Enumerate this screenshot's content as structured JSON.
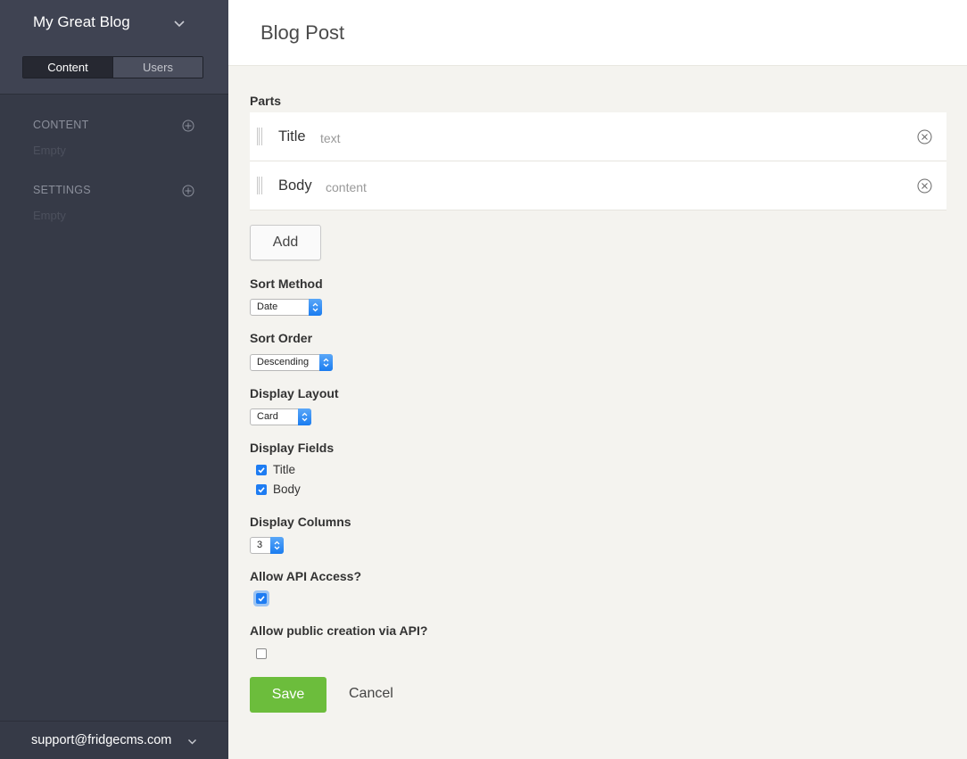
{
  "sidebar": {
    "site_name": "My Great Blog",
    "tabs": [
      {
        "label": "Content",
        "active": true
      },
      {
        "label": "Users",
        "active": false
      }
    ],
    "sections": [
      {
        "title": "CONTENT",
        "empty_label": "Empty"
      },
      {
        "title": "SETTINGS",
        "empty_label": "Empty"
      }
    ],
    "footer_email": "support@fridgecms.com"
  },
  "header": {
    "title": "Blog Post"
  },
  "parts": {
    "label": "Parts",
    "items": [
      {
        "name": "Title",
        "type": "text"
      },
      {
        "name": "Body",
        "type": "content"
      }
    ],
    "add_label": "Add"
  },
  "fields": {
    "sort_method": {
      "label": "Sort Method",
      "value": "Date"
    },
    "sort_order": {
      "label": "Sort Order",
      "value": "Descending"
    },
    "display_layout": {
      "label": "Display Layout",
      "value": "Card"
    },
    "display_fields": {
      "label": "Display Fields",
      "options": [
        {
          "label": "Title",
          "checked": true
        },
        {
          "label": "Body",
          "checked": true
        }
      ]
    },
    "display_columns": {
      "label": "Display Columns",
      "value": "3"
    },
    "allow_api_access": {
      "label": "Allow API Access?",
      "checked": true
    },
    "allow_public_creation": {
      "label": "Allow public creation via API?",
      "checked": false
    }
  },
  "actions": {
    "save_label": "Save",
    "cancel_label": "Cancel"
  },
  "colors": {
    "sidebar_bg": "#363a47",
    "content_bg": "#f4f3ef",
    "save_green": "#6cbd3c",
    "select_blue": "#1a7cf0"
  }
}
